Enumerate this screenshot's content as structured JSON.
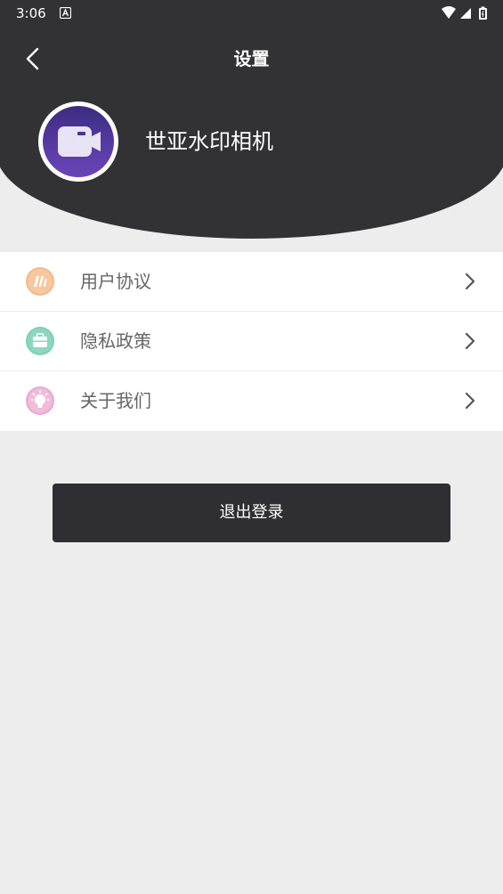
{
  "status_bar": {
    "time": "3:06",
    "icons": [
      "notification-a-icon",
      "wifi-icon",
      "cell-signal-icon",
      "battery-icon"
    ]
  },
  "header": {
    "title": "设置",
    "back_icon": "chevron-left-icon",
    "app_name": "世亚水印相机",
    "avatar_icon": "video-camera-icon",
    "background_color": "#323133"
  },
  "menu": {
    "items": [
      {
        "label": "用户协议",
        "icon": "agreement-icon",
        "icon_color": "#f6b98b"
      },
      {
        "label": "隐私政策",
        "icon": "briefcase-icon",
        "icon_color": "#7fcfb7"
      },
      {
        "label": "关于我们",
        "icon": "lightbulb-icon",
        "icon_color": "#e8a9cf"
      }
    ],
    "chevron_icon": "chevron-right-icon"
  },
  "logout": {
    "label": "退出登录"
  },
  "colors": {
    "page_background": "#ededed",
    "button_background": "#2f2e32",
    "avatar_gradient": [
      "#3b2c7f",
      "#6a45b4"
    ]
  }
}
